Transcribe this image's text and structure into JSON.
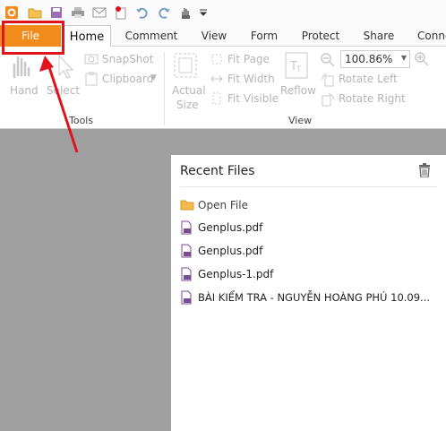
{
  "tabs": [
    {
      "label": "File"
    },
    {
      "label": "Home"
    },
    {
      "label": "Comment"
    },
    {
      "label": "View"
    },
    {
      "label": "Form"
    },
    {
      "label": "Protect"
    },
    {
      "label": "Share"
    },
    {
      "label": "Conne"
    }
  ],
  "ribbon": {
    "hand": "Hand",
    "select": "Select",
    "snapshot": "SnapShot",
    "clipboard": "Clipboard",
    "actual_size_line1": "Actual",
    "actual_size_line2": "Size",
    "fit_page": "Fit Page",
    "fit_width": "Fit Width",
    "fit_visible": "Fit Visible",
    "reflow": "Reflow",
    "zoom_value": "100.86%",
    "rotate_left": "Rotate Left",
    "rotate_right": "Rotate Right",
    "group_tools": "Tools",
    "group_view": "View"
  },
  "panel": {
    "title": "Recent Files",
    "open_file": "Open File",
    "files": [
      "Genplus.pdf",
      "Genplus.pdf",
      "Genplus-1.pdf",
      "BÀI KIỂM TRA - NGUYỄN HOÀNG PHÚ 10.09..."
    ]
  },
  "colors": {
    "file_tab": "#f08b1c",
    "highlight": "#e0141c",
    "workspace": "#a0a0a0"
  }
}
